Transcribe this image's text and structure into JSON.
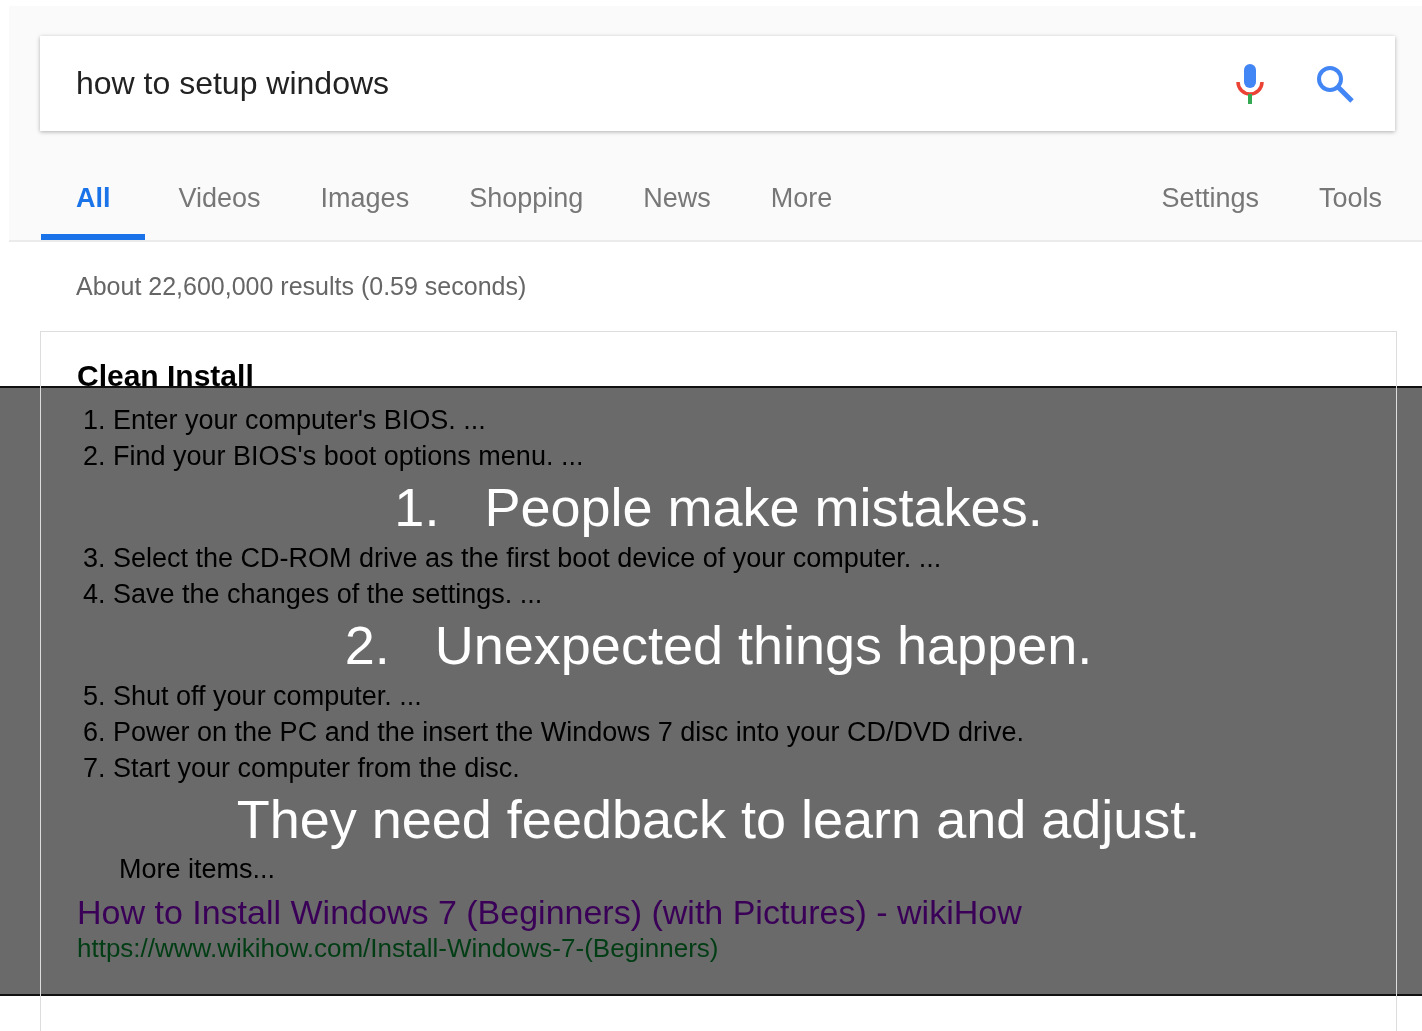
{
  "search": {
    "value": "how to setup windows"
  },
  "tabs": [
    {
      "label": "All",
      "selected": true
    },
    {
      "label": "Videos",
      "selected": false
    },
    {
      "label": "Images",
      "selected": false
    },
    {
      "label": "Shopping",
      "selected": false
    },
    {
      "label": "News",
      "selected": false
    },
    {
      "label": "More",
      "selected": false
    }
  ],
  "tools": [
    "Settings",
    "Tools"
  ],
  "result_stats": "About 22,600,000 results (0.59 seconds)",
  "snippet": {
    "heading": "Clean Install",
    "steps": [
      {
        "number": "1.",
        "text": "Enter your computer's BIOS. ..."
      },
      {
        "number": "2.",
        "text": "Find your BIOS's boot options menu. ..."
      },
      {
        "number": "3.",
        "text": "Select the CD-ROM drive as the first boot device of your computer. ..."
      },
      {
        "number": "4.",
        "text": "Save the changes of the settings. ..."
      },
      {
        "number": "5.",
        "text": "Shut off your computer. ..."
      },
      {
        "number": "6.",
        "text": "Power on the PC and the insert the Windows 7 disc into your CD/DVD drive."
      },
      {
        "number": "7.",
        "text": "Start your computer from the disc."
      }
    ],
    "more_items": "More items...",
    "result_title": "How to Install Windows 7 (Beginners) (with Pictures) - wikiHow",
    "result_url": "https://www.wikihow.com/Install-Windows-7-(Beginners)"
  },
  "overlay": {
    "points": [
      {
        "number": "1.",
        "text": "People make mistakes."
      },
      {
        "number": "2.",
        "text": "Unexpected things happen."
      }
    ],
    "conclusion": "They need feedback to learn and adjust."
  }
}
